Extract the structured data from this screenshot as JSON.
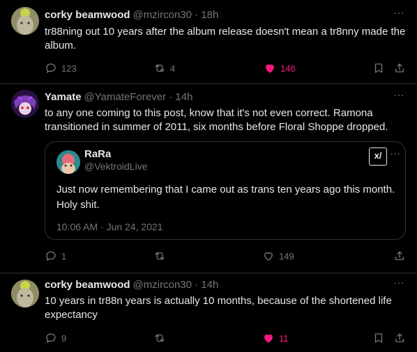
{
  "posts": [
    {
      "name": "corky beamwood",
      "handle": "@mzircon30",
      "sep": "·",
      "time": "18h",
      "text": "tr88ning out 10 years after the album release doesn't mean a tr8nny made the album.",
      "replies": "123",
      "reposts": "4",
      "likes": "146",
      "liked": true
    },
    {
      "name": "Yamate",
      "handle": "@YamateForever",
      "sep": "·",
      "time": "14h",
      "text": "to any one coming to this post, know that it's not even correct. Ramona transitioned in summer of 2011, six months before Floral Shoppe dropped.",
      "replies": "1",
      "reposts": "",
      "likes": "149",
      "liked": false,
      "quote": {
        "name": "RaRa",
        "handle": "@VektroidLive",
        "badge": "x/",
        "text": "Just now remembering that I came out as trans ten years ago this month. Holy shit.",
        "timestamp": "10:06 AM · Jun 24, 2021"
      }
    },
    {
      "name": "corky beamwood",
      "handle": "@mzircon30",
      "sep": "·",
      "time": "14h",
      "text": "10 years in tr88n years is actually 10 months, because of the shortened life expectancy",
      "replies": "9",
      "reposts": "",
      "likes": "11",
      "liked": true
    }
  ],
  "more_glyph": "···",
  "colors": {
    "like": "#f91880",
    "muted": "#71767b",
    "text": "#e7e9ea",
    "border": "#2f3336"
  }
}
